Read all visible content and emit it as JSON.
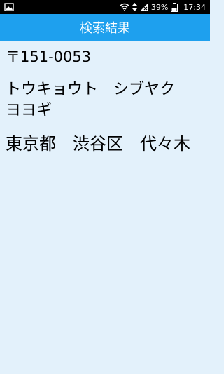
{
  "status_bar": {
    "left_icon": "image-notification-icon",
    "wifi_icon": "wifi-icon",
    "data_icon": "mobile-data-arrows-icon",
    "signal_icon": "signal-x-icon",
    "battery_percent": "39%",
    "battery_icon": "battery-icon",
    "time": "17:34"
  },
  "header": {
    "title": "検索結果"
  },
  "result": {
    "postal_code": "〒151-0053",
    "kana": "トウキョウト　シブヤク\nヨヨギ",
    "kanji": "東京都　渋谷区　代々木"
  },
  "colors": {
    "status_bar_bg": "#000000",
    "header_bg": "#1ea0ee",
    "content_bg": "#e3f1fb"
  }
}
